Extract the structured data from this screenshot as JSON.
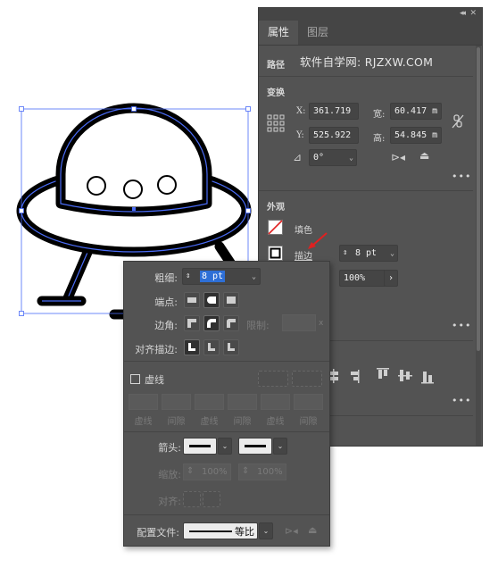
{
  "panel": {
    "tabs": [
      {
        "label": "属性",
        "active": true
      },
      {
        "label": "图层",
        "active": false
      }
    ],
    "path_label": "路径",
    "path_value": "软件自学网: RJZXW.COM",
    "transform": {
      "title": "变换",
      "x_label": "X:",
      "x_value": "361.719",
      "y_label": "Y:",
      "y_value": "525.922",
      "w_label": "宽:",
      "w_value": "60.417 m",
      "h_label": "高:",
      "h_value": "54.845 m",
      "angle_value": "0°"
    },
    "appearance": {
      "title": "外观",
      "fill_label": "填色",
      "stroke_label": "描边",
      "stroke_weight": "8 pt",
      "opacity": "100%"
    },
    "more": "•••"
  },
  "stroke_flyout": {
    "weight_label": "粗细:",
    "weight_value": "8 pt",
    "cap_label": "端点:",
    "corner_label": "边角:",
    "limit_label": "限制:",
    "limit_suffix": "x",
    "align_label": "对齐描边:",
    "dashed_label": "虚线",
    "dash_labels": [
      "虚线",
      "间隙",
      "虚线",
      "间隙",
      "虚线",
      "间隙"
    ],
    "arrow_label": "箭头:",
    "scale_label": "缩放:",
    "scale_start": "100%",
    "scale_end": "100%",
    "align2_label": "对齐:",
    "profile_label": "配置文件:",
    "profile_value": "等比"
  },
  "colors": {
    "panel_bg": "#535353",
    "panel_dark": "#454545",
    "selection_blue": "#4a6cf7",
    "stroke_black": "#000000",
    "arrow_red": "#e02020"
  }
}
